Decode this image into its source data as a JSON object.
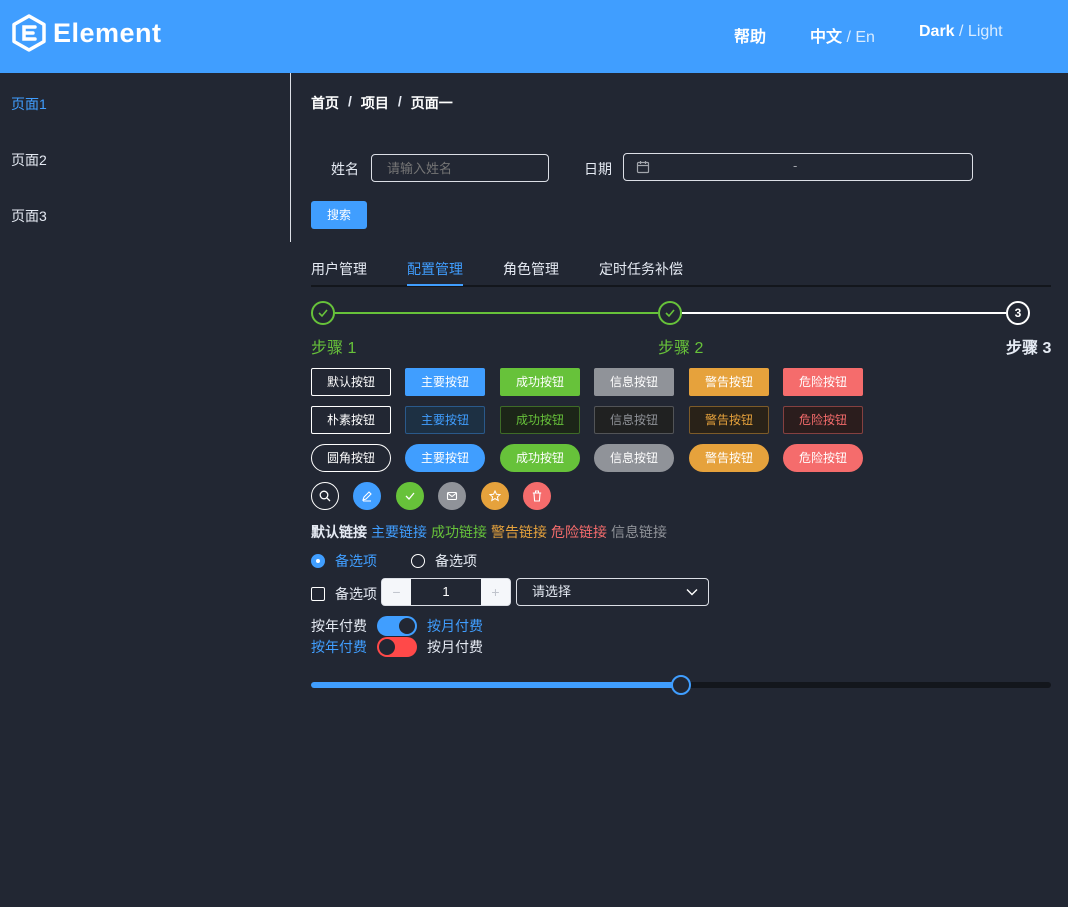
{
  "header": {
    "logo_text": "Element",
    "help": "帮助",
    "lang_active": "中文",
    "lang_sep": " / ",
    "lang_other": "En",
    "theme_active": "Dark",
    "theme_sep": " / ",
    "theme_other": "Light"
  },
  "sidebar": {
    "items": [
      {
        "label": "页面1"
      },
      {
        "label": "页面2"
      },
      {
        "label": "页面3"
      }
    ]
  },
  "breadcrumb": {
    "items": [
      "首页",
      "项目",
      "页面一"
    ],
    "separator": "/"
  },
  "form": {
    "name_label": "姓名",
    "name_placeholder": "请输入姓名",
    "date_label": "日期",
    "date_range_sep": "-",
    "search_label": "搜索"
  },
  "tabs": {
    "items": [
      {
        "label": "用户管理"
      },
      {
        "label": "配置管理"
      },
      {
        "label": "角色管理"
      },
      {
        "label": "定时任务补偿"
      }
    ],
    "active_index": 1
  },
  "steps": {
    "items": [
      {
        "title": "步骤 1",
        "status": "success"
      },
      {
        "title": "步骤 2",
        "status": "success"
      },
      {
        "title": "步骤 3",
        "status": "wait",
        "number": "3"
      }
    ]
  },
  "buttons": {
    "row1": [
      "默认按钮",
      "主要按钮",
      "成功按钮",
      "信息按钮",
      "警告按钮",
      "危险按钮"
    ],
    "row2": [
      "朴素按钮",
      "主要按钮",
      "成功按钮",
      "信息按钮",
      "警告按钮",
      "危险按钮"
    ],
    "row3": [
      "圆角按钮",
      "主要按钮",
      "成功按钮",
      "信息按钮",
      "警告按钮",
      "危险按钮"
    ],
    "circle_icons": [
      "search-icon",
      "edit-icon",
      "check-icon",
      "message-icon",
      "star-icon",
      "delete-icon"
    ]
  },
  "links": [
    "默认链接",
    "主要链接",
    "成功链接",
    "警告链接",
    "危险链接",
    "信息链接"
  ],
  "radios": {
    "options": [
      {
        "label": "备选项",
        "checked": true
      },
      {
        "label": "备选项",
        "checked": false
      }
    ]
  },
  "checkbox": {
    "label": "备选项",
    "checked": false
  },
  "input_number": {
    "value": "1",
    "minus": "−",
    "plus": "+"
  },
  "select": {
    "placeholder": "请选择"
  },
  "switches": [
    {
      "left": "按年付费",
      "right": "按月付费",
      "on": true
    },
    {
      "left": "按年付费",
      "right": "按月付费",
      "on": false
    }
  ],
  "slider": {
    "value": 50
  },
  "colors": {
    "primary": "#409eff",
    "success": "#67c23a",
    "info": "#909399",
    "warning": "#e6a23c",
    "danger": "#f56c6c",
    "background": "#222733"
  }
}
